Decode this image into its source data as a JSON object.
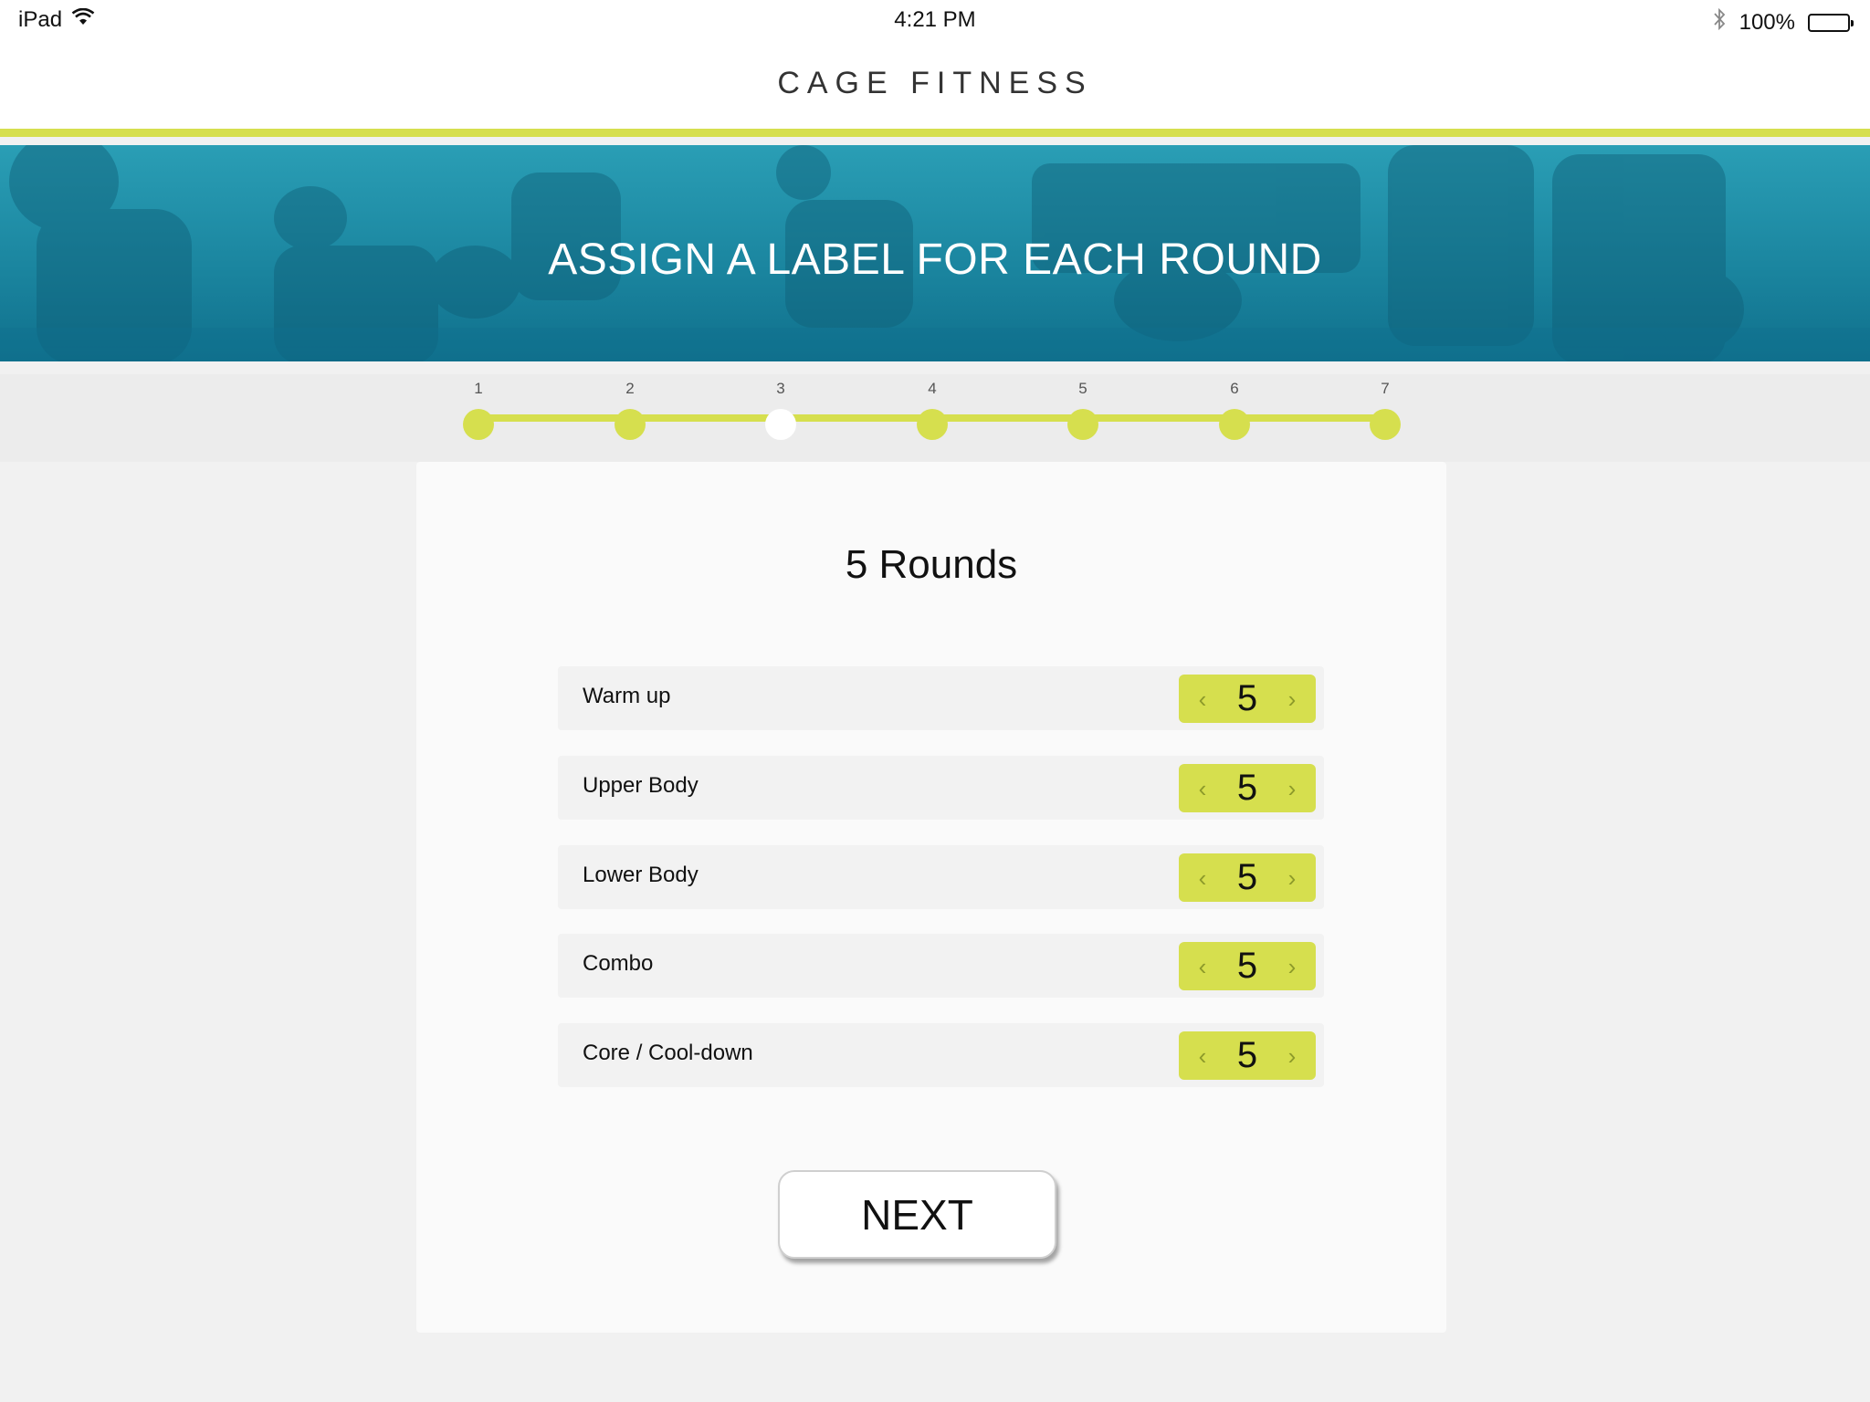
{
  "status_bar": {
    "device": "iPad",
    "time": "4:21 PM",
    "battery_text": "100%",
    "battery_level": 1.0
  },
  "header": {
    "title": "CAGE FITNESS"
  },
  "banner": {
    "title": "ASSIGN A LABEL FOR EACH ROUND"
  },
  "progress": {
    "steps": [
      "1",
      "2",
      "3",
      "4",
      "5",
      "6",
      "7"
    ],
    "current_step": 3
  },
  "card": {
    "title": "5 Rounds",
    "rounds": [
      {
        "label": "Warm up",
        "value": "5"
      },
      {
        "label": "Upper Body",
        "value": "5"
      },
      {
        "label": "Lower Body",
        "value": "5"
      },
      {
        "label": "Combo",
        "value": "5"
      },
      {
        "label": "Core / Cool-down",
        "value": "5"
      }
    ],
    "next_label": "NEXT"
  },
  "colors": {
    "accent": "#d6df4e",
    "banner": "#1b86a0",
    "page_bg": "#f1f1f1"
  },
  "icons": {
    "wifi": "wifi-icon",
    "bluetooth": "bluetooth-icon",
    "battery": "battery-icon",
    "decrement": "chevron-left-icon",
    "increment": "chevron-right-icon"
  }
}
